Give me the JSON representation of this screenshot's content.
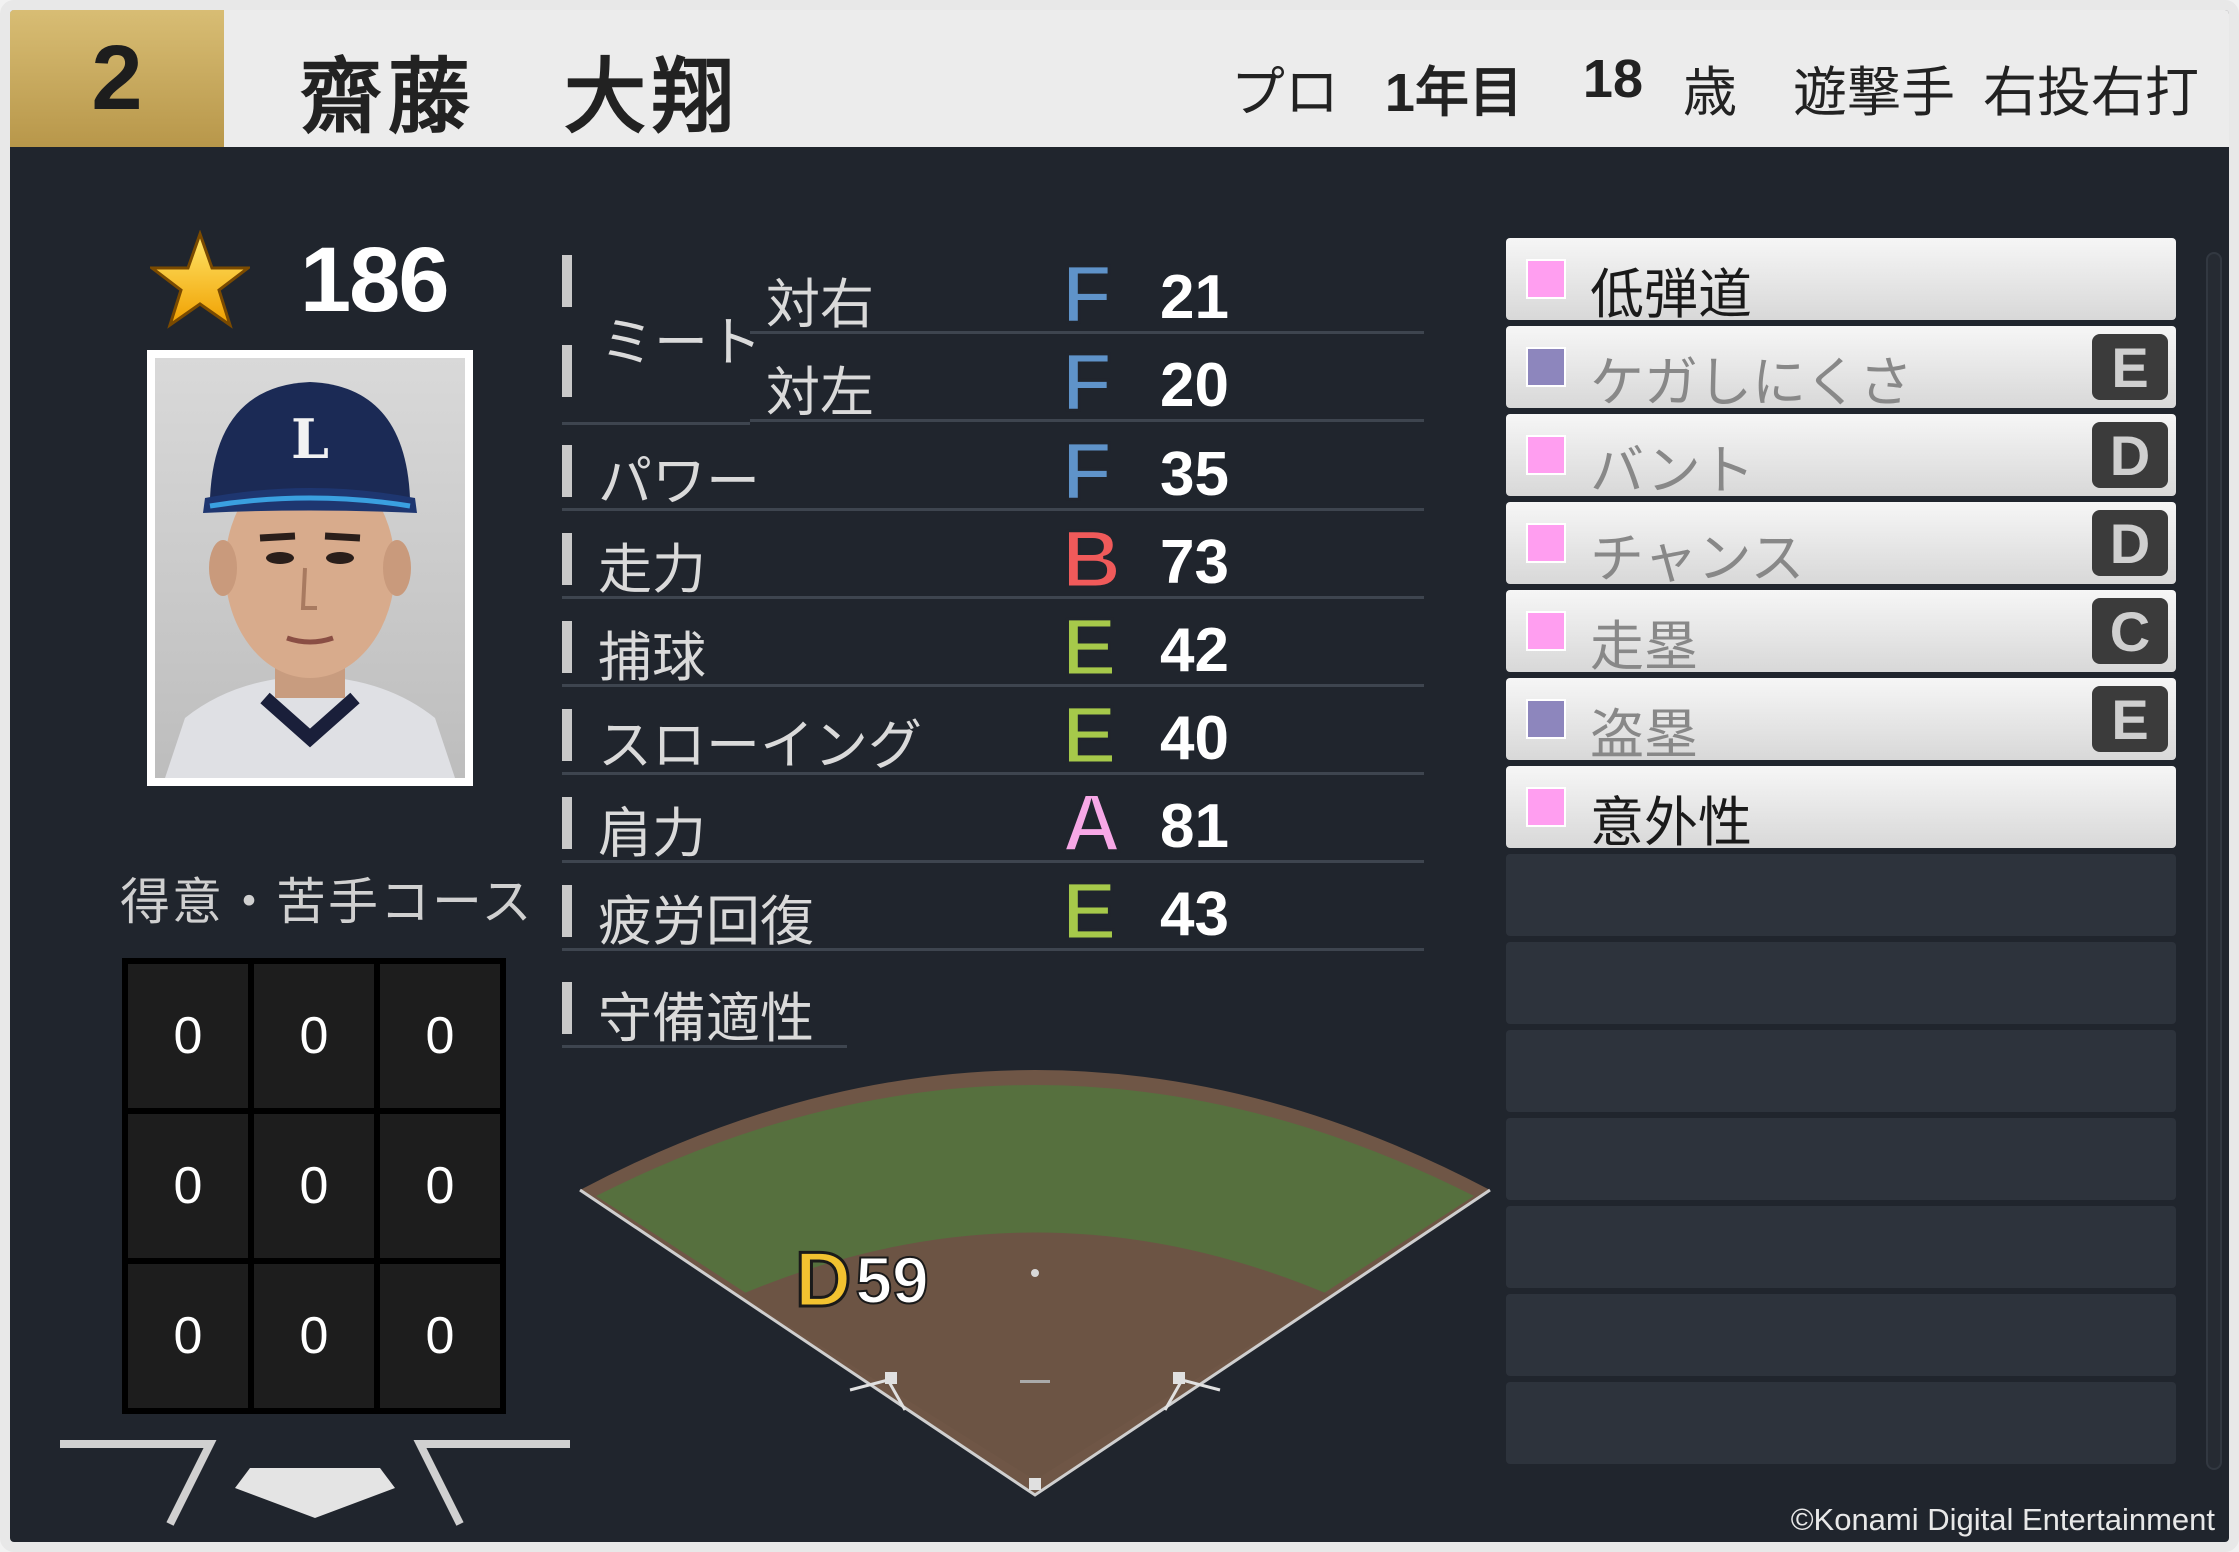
{
  "header": {
    "number": "2",
    "name": "齋藤　大翔",
    "status": "プロ",
    "year": "1年目",
    "age": "18",
    "age_unit": "歳",
    "position": "遊撃手",
    "handedness": "右投右打"
  },
  "overall": {
    "icon": "star-icon",
    "value": "186"
  },
  "zone": {
    "title": "得意・苦手コース",
    "cells": [
      "0",
      "0",
      "0",
      "0",
      "0",
      "0",
      "0",
      "0",
      "0"
    ]
  },
  "stats": {
    "meet_label": "ミート",
    "meet_right": {
      "label": "対右",
      "grade": "F",
      "value": "21"
    },
    "meet_left": {
      "label": "対左",
      "grade": "F",
      "value": "20"
    },
    "rows": [
      {
        "label": "パワー",
        "grade": "F",
        "value": "35"
      },
      {
        "label": "走力",
        "grade": "B",
        "value": "73"
      },
      {
        "label": "捕球",
        "grade": "E",
        "value": "42"
      },
      {
        "label": "スローイング",
        "grade": "E",
        "value": "40"
      },
      {
        "label": "肩力",
        "grade": "A",
        "value": "81"
      },
      {
        "label": "疲労回復",
        "grade": "E",
        "value": "43"
      }
    ],
    "defense_label": "守備適性"
  },
  "fielding": {
    "grade": "D",
    "value": "59"
  },
  "grade_colors": {
    "A": "#f7a8e6",
    "B": "#f05a5a",
    "C": "#f0a030",
    "D": "#f2c230",
    "E": "#a6c94a",
    "F": "#5f93c9"
  },
  "abilities": [
    {
      "label": "低弾道",
      "grade": "",
      "color": "#ff9ef0",
      "text_color": "#1a1a1a"
    },
    {
      "label": "ケガしにくさ",
      "grade": "E",
      "color": "#8d86bd",
      "text_color": "#888888"
    },
    {
      "label": "バント",
      "grade": "D",
      "color": "#ff9ef0",
      "text_color": "#888888"
    },
    {
      "label": "チャンス",
      "grade": "D",
      "color": "#ff9ef0",
      "text_color": "#888888"
    },
    {
      "label": "走塁",
      "grade": "C",
      "color": "#ff9ef0",
      "text_color": "#888888"
    },
    {
      "label": "盗塁",
      "grade": "E",
      "color": "#8d86bd",
      "text_color": "#888888"
    },
    {
      "label": "意外性",
      "grade": "",
      "color": "#ff9ef0",
      "text_color": "#1a1a1a"
    }
  ],
  "copyright": "©Konami Digital Entertainment"
}
